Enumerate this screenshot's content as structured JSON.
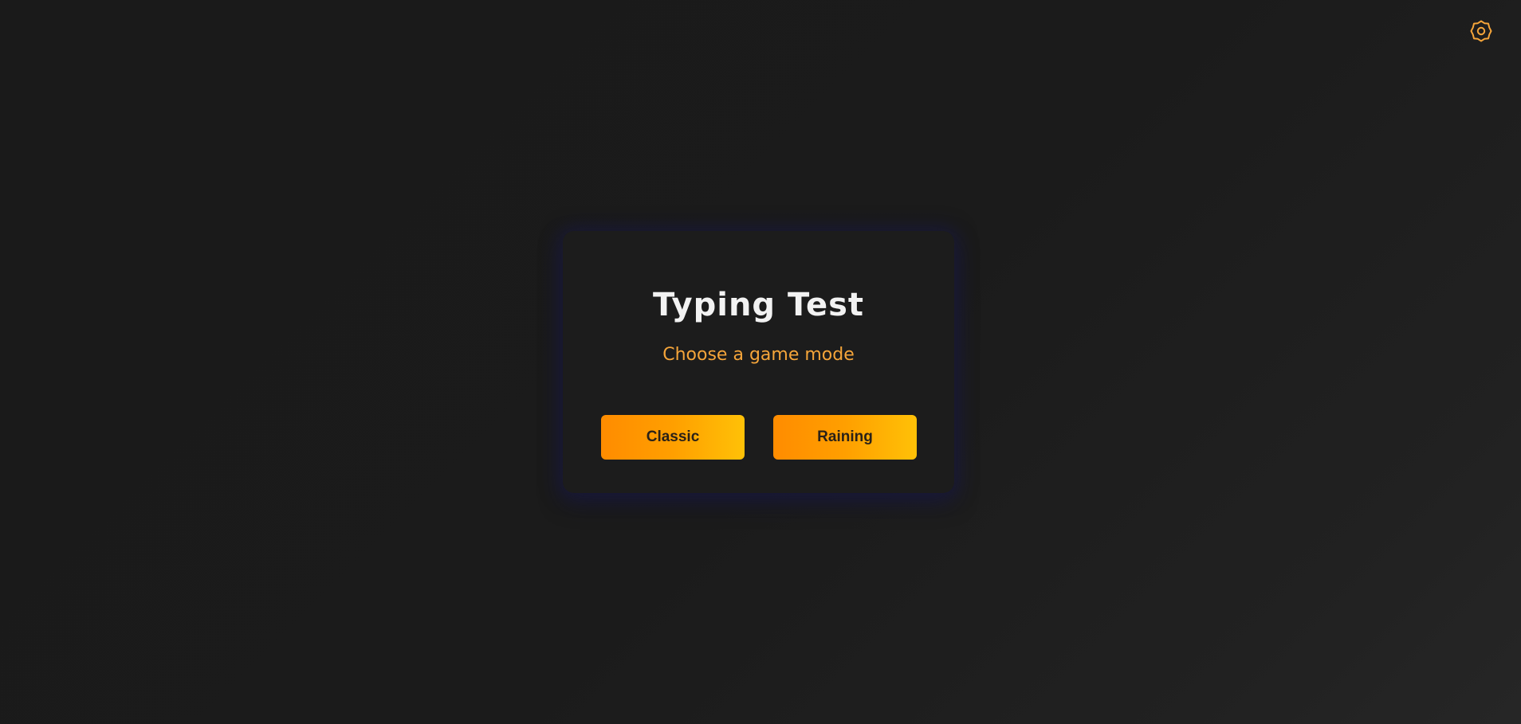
{
  "header": {
    "settings_icon": "settings-gear-icon",
    "accent_color": "#f5a53a"
  },
  "card": {
    "title": "Typing Test",
    "subtitle": "Choose a game mode",
    "modes": [
      {
        "label": "Classic"
      },
      {
        "label": "Raining"
      }
    ]
  },
  "colors": {
    "background": "#1b1b1b",
    "card_background": "#1c1c1c",
    "button_gradient_start": "#ff8c00",
    "button_gradient_end": "#ffc107",
    "title_color": "#f2f2f2"
  }
}
